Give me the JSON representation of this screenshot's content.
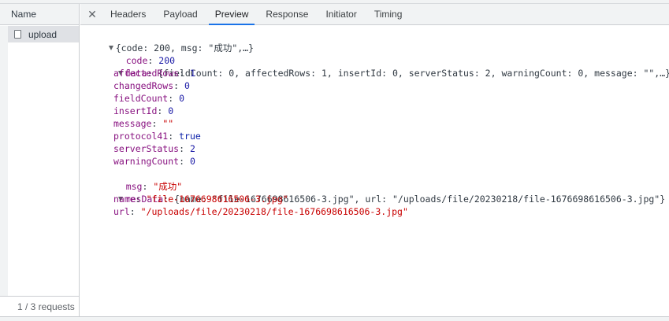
{
  "left_panel": {
    "header": "Name",
    "requests": [
      {
        "name": "upload"
      }
    ],
    "footer": "1 / 3 requests"
  },
  "tabs": [
    {
      "label": "Headers",
      "active": false
    },
    {
      "label": "Payload",
      "active": false
    },
    {
      "label": "Preview",
      "active": true
    },
    {
      "label": "Response",
      "active": false
    },
    {
      "label": "Initiator",
      "active": false
    },
    {
      "label": "Timing",
      "active": false
    }
  ],
  "preview": {
    "root_summary": "{code: 200, msg: \"成功\",…}",
    "code": {
      "key": "code",
      "value": "200"
    },
    "data": {
      "key": "data",
      "summary": "{fieldCount: 0, affectedRows: 1, insertId: 0, serverStatus: 2, warningCount: 0, message: \"\",…}",
      "fields": [
        {
          "key": "affectedRows",
          "value": "1",
          "kind": "num"
        },
        {
          "key": "changedRows",
          "value": "0",
          "kind": "num"
        },
        {
          "key": "fieldCount",
          "value": "0",
          "kind": "num"
        },
        {
          "key": "insertId",
          "value": "0",
          "kind": "num"
        },
        {
          "key": "message",
          "value": "\"\"",
          "kind": "str"
        },
        {
          "key": "protocol41",
          "value": "true",
          "kind": "bool"
        },
        {
          "key": "serverStatus",
          "value": "2",
          "kind": "num"
        },
        {
          "key": "warningCount",
          "value": "0",
          "kind": "num"
        }
      ]
    },
    "msg": {
      "key": "msg",
      "value": "\"成功\""
    },
    "resData": {
      "key": "resData",
      "summary": "{name: \"file-1676698616506-3.jpg\", url: \"/uploads/file/20230218/file-1676698616506-3.jpg\"}",
      "fields": [
        {
          "key": "name",
          "value": "\"file-1676698616506-3.jpg\"",
          "kind": "str"
        },
        {
          "key": "url",
          "value": "\"/uploads/file/20230218/file-1676698616506-3.jpg\"",
          "kind": "str"
        }
      ]
    }
  },
  "colors": {
    "accent": "#1a73e8",
    "key": "#881280",
    "number": "#1a1aa6",
    "string": "#c80000"
  },
  "icons": {
    "close": "close-icon",
    "file": "file-icon",
    "expand": "triangle-down-icon"
  }
}
